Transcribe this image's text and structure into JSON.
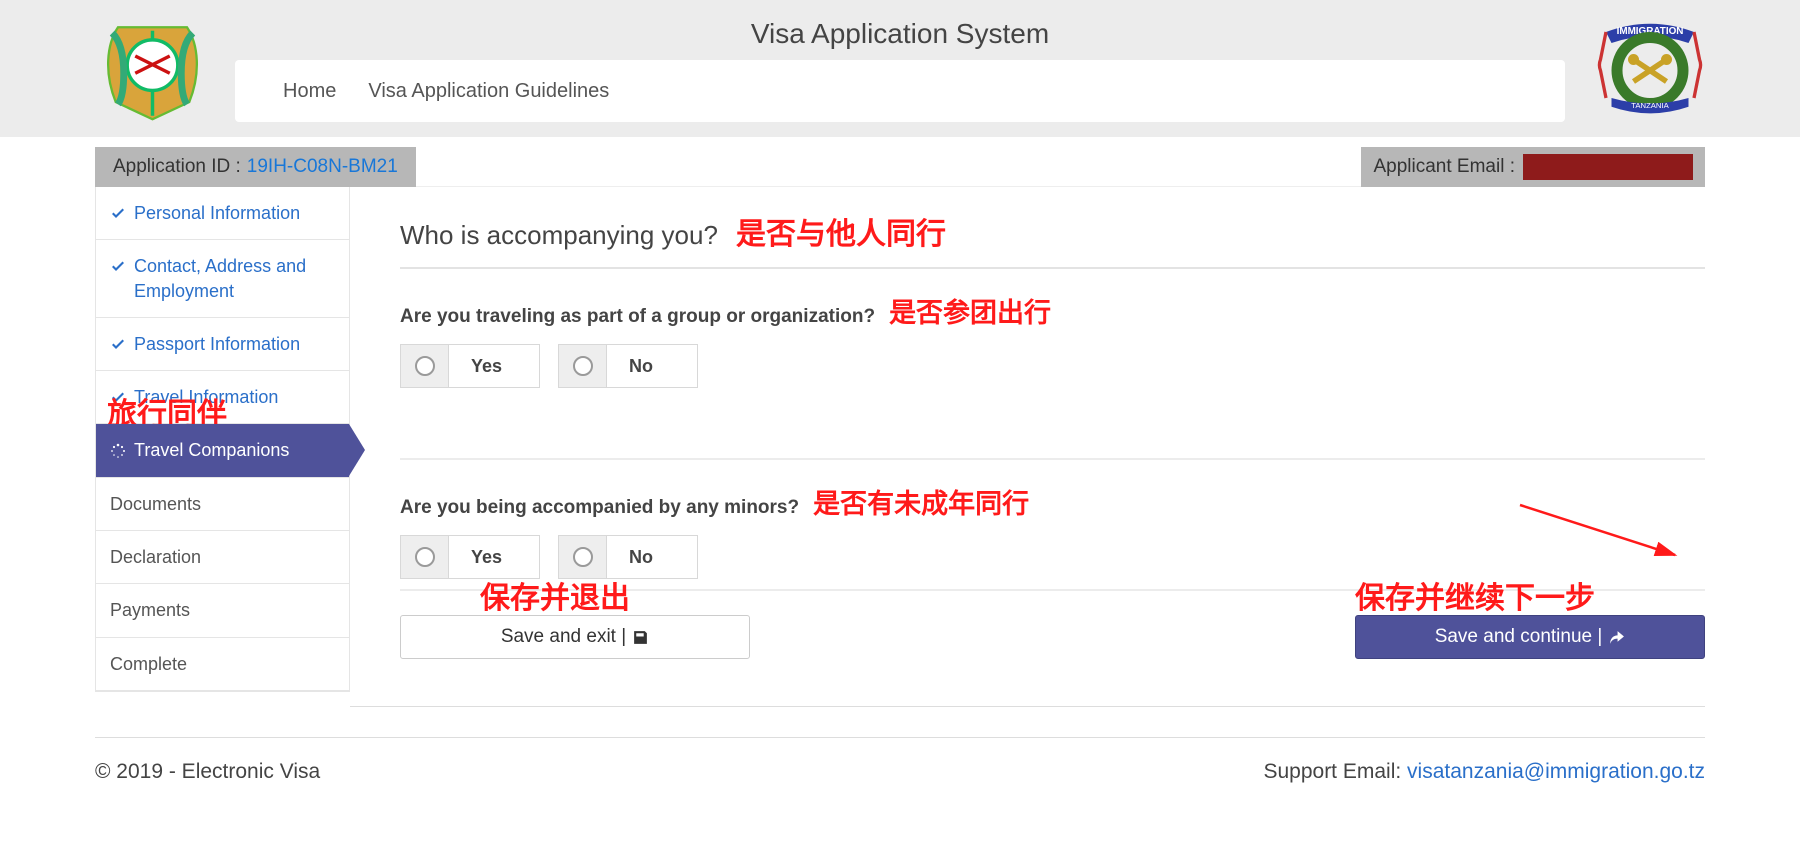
{
  "header": {
    "title": "Visa Application System",
    "nav": {
      "home": "Home",
      "guidelines": "Visa Application Guidelines"
    }
  },
  "app_bar": {
    "id_label": "Application ID :",
    "id_value": "19IH-C08N-BM21",
    "email_label": "Applicant Email :"
  },
  "sidebar": {
    "items": [
      {
        "label": "Personal Information",
        "done": true
      },
      {
        "label": "Contact, Address and Employment",
        "done": true
      },
      {
        "label": "Passport Information",
        "done": true
      },
      {
        "label": "Travel Information",
        "done": true
      },
      {
        "label": "Travel Companions",
        "active": true
      },
      {
        "label": "Documents"
      },
      {
        "label": "Declaration"
      },
      {
        "label": "Payments"
      },
      {
        "label": "Complete"
      }
    ]
  },
  "main": {
    "heading": "Who is accompanying you?",
    "q1": "Are you traveling as part of a group or organization?",
    "q2": "Are you being accompanied by any minors?",
    "yes": "Yes",
    "no": "No",
    "save_exit": "Save and exit |",
    "save_continue": "Save and continue |"
  },
  "annotations": {
    "heading": "是否与他人同行",
    "q1": "是否参团出行",
    "q2": "是否有未成年同行",
    "travel_companions": "旅行同伴",
    "save_exit": "保存并退出",
    "save_continue": "保存并继续下一步"
  },
  "footer": {
    "copyright": "© 2019 - Electronic Visa",
    "support_label": "Support Email:",
    "support_email": "visatanzania@immigration.go.tz"
  }
}
